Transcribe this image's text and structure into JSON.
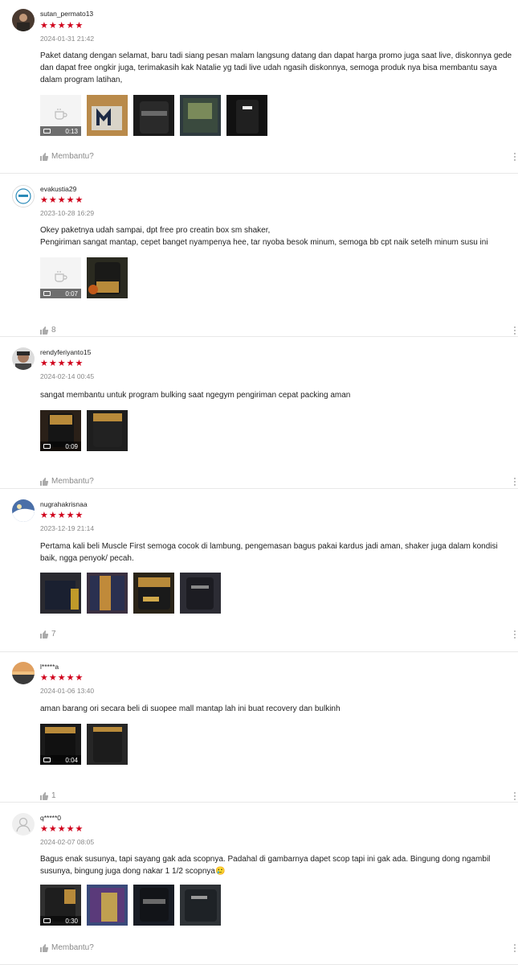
{
  "reviews": [
    {
      "username": "sutan_permato13",
      "stars": "★★★★★",
      "date": "2024-01-31 21:42",
      "text": "Paket datang dengan selamat, baru tadi siang pesan malam langsung datang dan dapat harga promo juga saat live, diskonnya gede dan dapat free ongkir juga, terimakasih kak Natalie yg tadi live udah ngasih diskonnya, semoga produk nya bisa membantu saya dalam program latihan,",
      "video_duration": "0:13",
      "helpful_label": "Membantu?",
      "avatar_color": "#4a3a30",
      "image_colors": [
        "#b98a4a",
        "#1a1a1a",
        "#2e3a3e",
        "#111111"
      ]
    },
    {
      "username": "evakustia29",
      "stars": "★★★★★",
      "date": "2023-10-28 16:29",
      "text": "Okey paketnya udah sampai, dpt free pro creatin box sm shaker,\nPengiriman sangat mantap, cepet banget nyampenya hee, tar nyoba besok minum, semoga bb cpt naik setelh minum susu ini",
      "video_duration": "0:07",
      "helpful_label": "8",
      "avatar_color": "#ffffff",
      "image_colors": [
        "#2a2a20"
      ]
    },
    {
      "username": "rendyferiyanto15",
      "stars": "★★★★★",
      "date": "2024-02-14 00:45",
      "text": "sangat membantu untuk program bulking saat ngegym pengiriman cepat packing aman",
      "video_duration": "0:09",
      "helpful_label": "Membantu?",
      "avatar_color": "#8a6a5a",
      "video_color": "#2a2018",
      "image_colors": [
        "#1e1e1e"
      ]
    },
    {
      "username": "nugrahakrisnaa",
      "stars": "★★★★★",
      "date": "2023-12-19 21:14",
      "text": "Pertama kali beli Muscle First semoga cocok di lambung, pengemasan bagus pakai kardus jadi aman, shaker juga dalam kondisi baik, ngga penyok/ pecah.",
      "helpful_label": "7",
      "avatar_color": "#4a6fa8",
      "image_colors": [
        "#2a2a30",
        "#3a3040",
        "#2a2418",
        "#2c2c34"
      ]
    },
    {
      "username": "l*****a",
      "stars": "★★★★★",
      "date": "2024-01-06 13:40",
      "text": "aman barang ori secara beli di suopee mall mantap lah ini buat recovery dan bulkinh",
      "video_duration": "0:04",
      "helpful_label": "1",
      "avatar_color": "#b0703a",
      "video_color": "#1a1a1a",
      "image_colors": [
        "#262626"
      ]
    },
    {
      "username": "q*****0",
      "stars": "★★★★★",
      "date": "2024-02-07 08:05",
      "text": "Bagus enak susunya, tapi sayang gak ada scopnya. Padahal di gambarnya dapet scop tapi ini gak ada. Bingung dong ngambil susunya, bingung juga dong nakar 1 1/2 scopnya🥲",
      "video_duration": "0:30",
      "helpful_label": "Membantu?",
      "avatar_color": "#e8e8e8",
      "video_color": "#303030",
      "image_colors": [
        "#3a4a7a",
        "#181c24",
        "#2e3236"
      ]
    }
  ]
}
